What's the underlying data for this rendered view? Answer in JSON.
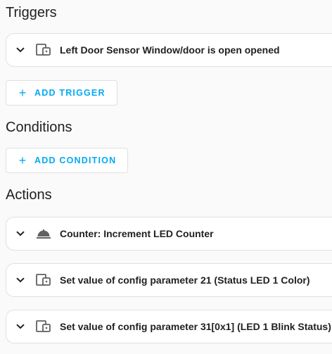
{
  "triggers": {
    "title": "Triggers",
    "items": [
      {
        "label": "Left Door Sensor Window/door is open opened",
        "icon": "device-icon"
      }
    ],
    "add_label": "ADD TRIGGER"
  },
  "conditions": {
    "title": "Conditions",
    "add_label": "ADD CONDITION"
  },
  "actions": {
    "title": "Actions",
    "items": [
      {
        "label": "Counter: Increment LED Counter",
        "icon": "service-bell-icon"
      },
      {
        "label": "Set value of config parameter 21 (Status LED 1 Color)",
        "icon": "device-icon"
      },
      {
        "label": "Set value of config parameter 31[0x1] (LED 1 Blink Status)",
        "icon": "device-icon"
      }
    ]
  },
  "colors": {
    "accent": "#03a9f4",
    "border": "#e0e0e0",
    "icon": "#616161"
  }
}
